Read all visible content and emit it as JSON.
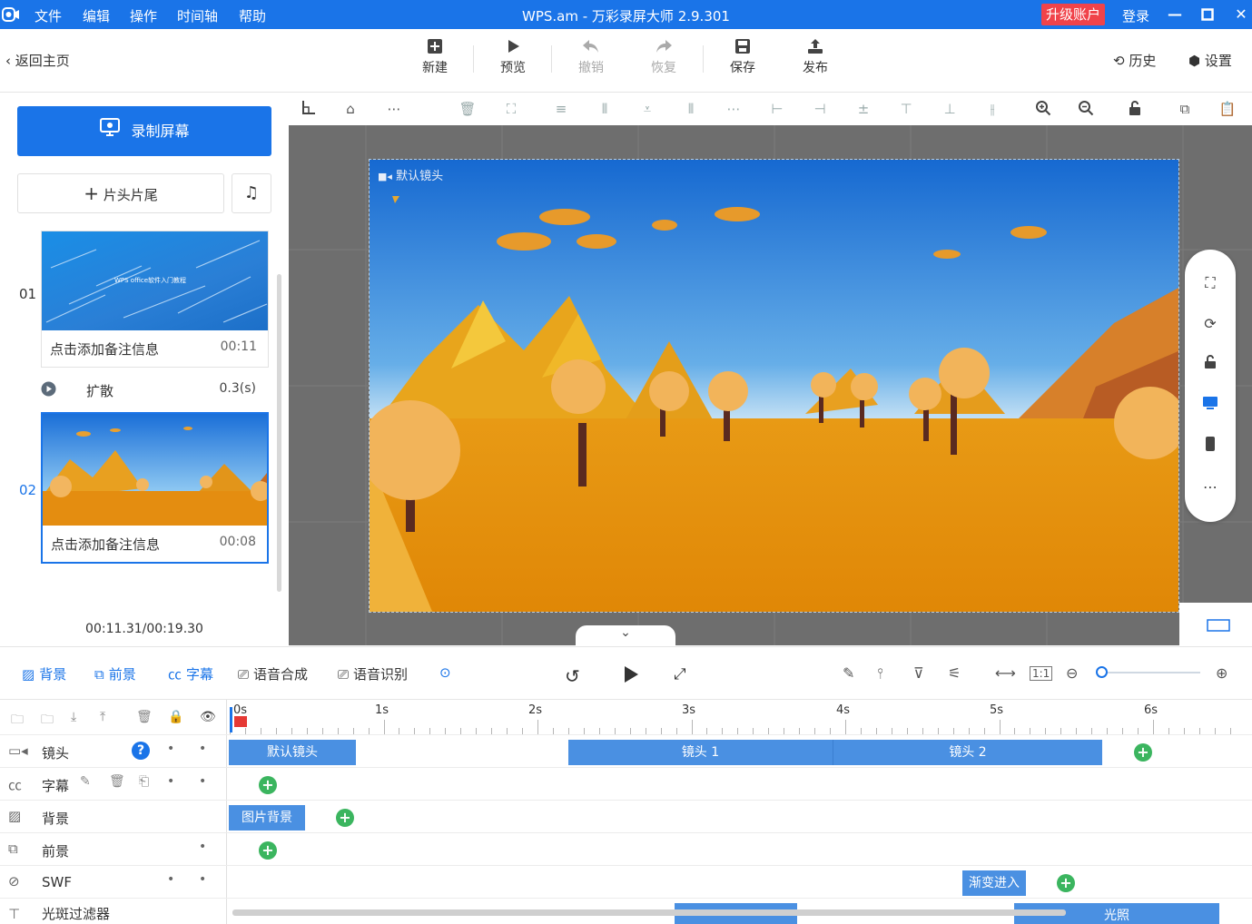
{
  "titlebar": {
    "menu": [
      "文件",
      "编辑",
      "操作",
      "时间轴",
      "帮助"
    ],
    "title": "WPS.am - 万彩录屏大师 2.9.301",
    "upgrade": "升级账户",
    "login": "登录",
    "accent": "#1a74e8"
  },
  "toolbar": {
    "back": "返回主页",
    "buttons": [
      {
        "label": "新建",
        "icon": "new-icon",
        "enabled": true
      },
      {
        "label": "预览",
        "icon": "play-icon",
        "enabled": true
      },
      {
        "label": "撤销",
        "icon": "undo-icon",
        "enabled": false
      },
      {
        "label": "恢复",
        "icon": "redo-icon",
        "enabled": false
      },
      {
        "label": "保存",
        "icon": "save-icon",
        "enabled": true
      },
      {
        "label": "发布",
        "icon": "publish-icon",
        "enabled": true
      }
    ],
    "history": "历史",
    "settings": "设置"
  },
  "left_panel": {
    "record_button": "录制屏幕",
    "title_tail_button": "片头片尾",
    "scenes": [
      {
        "number": "01",
        "note": "点击添加备注信息",
        "duration": "00:11",
        "thumb_text": "WPS office软件入门教程"
      },
      {
        "number": "02",
        "note": "点击添加备注信息",
        "duration": "00:08"
      }
    ],
    "transition": {
      "name": "扩散",
      "duration": "0.3(s)"
    },
    "time_display": "00:11.31/00:19.30"
  },
  "canvas": {
    "camera_label": "默认镜头"
  },
  "timeline_tabs": [
    {
      "label": "背景",
      "icon": "background-icon",
      "active": true
    },
    {
      "label": "前景",
      "icon": "foreground-icon",
      "active": true
    },
    {
      "label": "字幕",
      "icon": "subtitle-icon",
      "active": true
    },
    {
      "label": "语音合成",
      "icon": "tts-icon",
      "active": false
    },
    {
      "label": "语音识别",
      "icon": "asr-icon",
      "active": false
    }
  ],
  "ruler": {
    "labels": [
      "0s",
      "1s",
      "2s",
      "3s",
      "4s",
      "5s",
      "6s"
    ]
  },
  "tracks": [
    {
      "name": "镜头",
      "icon": "camera-icon",
      "clips": [
        "默认镜头",
        "镜头 1",
        "镜头 2"
      ]
    },
    {
      "name": "字幕",
      "icon": "subtitle-icon",
      "clips": []
    },
    {
      "name": "背景",
      "icon": "background-icon",
      "clips": [
        "图片背景"
      ]
    },
    {
      "name": "前景",
      "icon": "foreground-icon",
      "clips": []
    },
    {
      "name": "SWF",
      "icon": "swf-icon",
      "clips": [
        "渐变进入"
      ]
    },
    {
      "name": "光斑过滤器",
      "icon": "filter-icon",
      "clips": [
        "光照"
      ]
    }
  ]
}
